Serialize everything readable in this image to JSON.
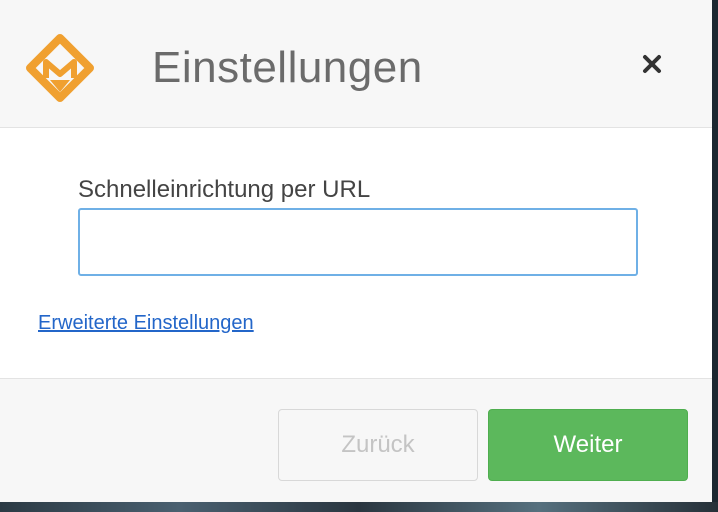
{
  "dialog": {
    "title": "Einstellungen",
    "close_icon": "close-icon"
  },
  "form": {
    "url_label": "Schnelleinrichtung per URL",
    "url_value": "",
    "url_placeholder": "",
    "advanced_link": "Erweiterte Einstellungen"
  },
  "footer": {
    "back_label": "Zurück",
    "back_enabled": false,
    "next_label": "Weiter"
  },
  "colors": {
    "accent": "#f0a030",
    "primary_button": "#5cb85c",
    "link": "#2366c9",
    "input_focus_border": "#6fb0e6"
  },
  "icons": {
    "logo": "orange-diamond-logo-icon",
    "close": "close-icon"
  }
}
